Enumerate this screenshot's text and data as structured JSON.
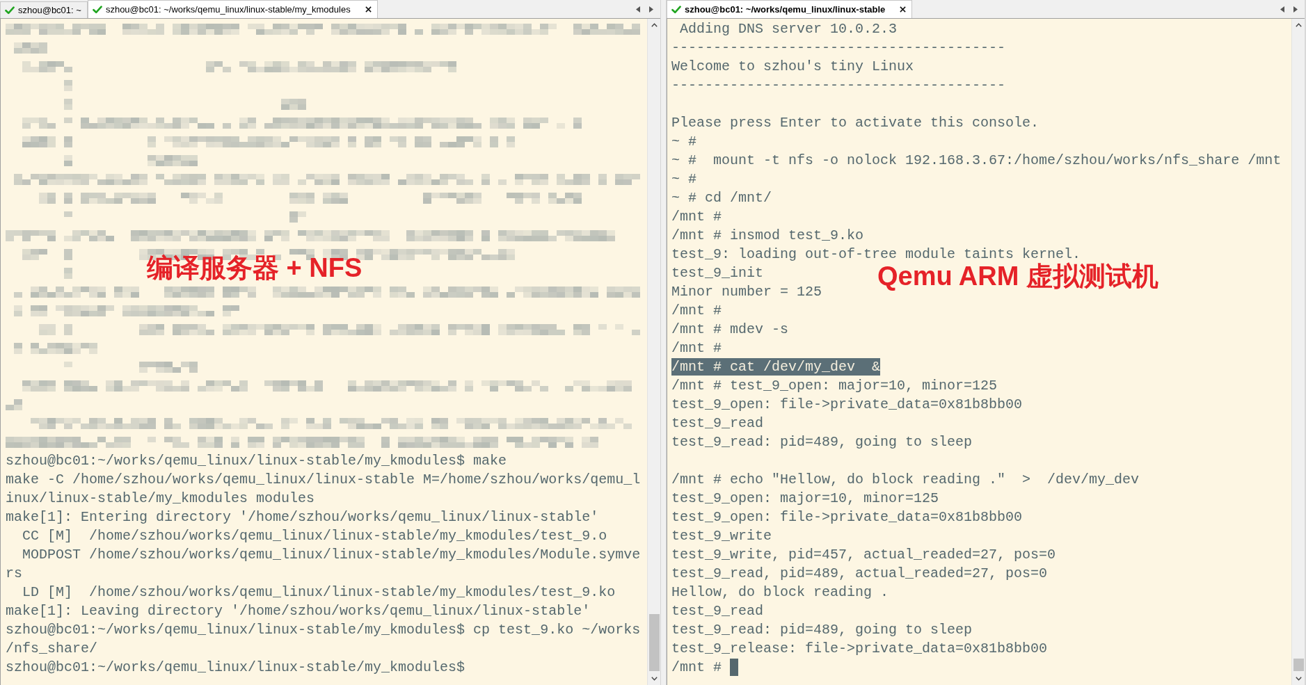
{
  "panes": [
    {
      "focused": false,
      "pixelated": true,
      "tabs": [
        {
          "label": "szhou@bc01: ~",
          "selected": false
        },
        {
          "label": "szhou@bc01: ~/works/qemu_linux/linux-stable/my_kmodules",
          "selected": true
        }
      ],
      "blocks": [
        {
          "lines": [
            {
              "text": "szhou@bc01:~/works/qemu_linux/linux-stable/my_kmodules$ make",
              "selected": false
            },
            {
              "text": "make -C /home/szhou/works/qemu_linux/linux-stable M=/home/szhou/works/qemu_l",
              "selected": false
            },
            {
              "text": "inux/linux-stable/my_kmodules modules",
              "selected": false
            },
            {
              "text": "make[1]: Entering directory '/home/szhou/works/qemu_linux/linux-stable'",
              "selected": false
            },
            {
              "text": "  CC [M]  /home/szhou/works/qemu_linux/linux-stable/my_kmodules/test_9.o",
              "selected": false
            },
            {
              "text": "  MODPOST /home/szhou/works/qemu_linux/linux-stable/my_kmodules/Module.symve",
              "selected": false
            },
            {
              "text": "rs",
              "selected": false
            },
            {
              "text": "  LD [M]  /home/szhou/works/qemu_linux/linux-stable/my_kmodules/test_9.ko",
              "selected": false
            },
            {
              "text": "make[1]: Leaving directory '/home/szhou/works/qemu_linux/linux-stable'",
              "selected": false
            },
            {
              "text": "szhou@bc01:~/works/qemu_linux/linux-stable/my_kmodules$ cp test_9.ko ~/works",
              "selected": false
            },
            {
              "text": "/nfs_share/",
              "selected": false
            },
            {
              "text": "szhou@bc01:~/works/qemu_linux/linux-stable/my_kmodules$",
              "selected": false
            }
          ]
        }
      ],
      "annotation": "编译服务器 + NFS"
    },
    {
      "focused": true,
      "tabs": [
        {
          "label": "szhou@bc01: ~/works/qemu_linux/linux-stable",
          "selected": true
        }
      ],
      "blocks": [
        {
          "lines": [
            {
              "text": " Adding DNS server 10.0.2.3",
              "selected": false
            },
            {
              "text": "----------------------------------------",
              "selected": false
            },
            {
              "text": "Welcome to szhou's tiny Linux",
              "selected": false
            },
            {
              "text": "----------------------------------------",
              "selected": false
            }
          ]
        },
        {
          "lines": [
            {
              "text": "Please press Enter to activate this console.",
              "selected": false
            },
            {
              "text": "~ #",
              "selected": false
            },
            {
              "text": "~ #  mount -t nfs -o nolock 192.168.3.67:/home/szhou/works/nfs_share /mnt",
              "selected": false
            },
            {
              "text": "~ #",
              "selected": false
            },
            {
              "text": "~ # cd /mnt/",
              "selected": false
            },
            {
              "text": "/mnt #",
              "selected": false
            },
            {
              "text": "/mnt # insmod test_9.ko",
              "selected": false
            },
            {
              "text": "test_9: loading out-of-tree module taints kernel.",
              "selected": false
            },
            {
              "text": "test_9_init",
              "selected": false
            },
            {
              "text": "Minor number = 125",
              "selected": false
            },
            {
              "text": "/mnt #",
              "selected": false
            },
            {
              "text": "/mnt # mdev -s",
              "selected": false
            },
            {
              "text": "/mnt #",
              "selected": false
            },
            {
              "text": "/mnt # cat /dev/my_dev  &",
              "selected": true
            },
            {
              "text": "/mnt # test_9_open: major=10, minor=125",
              "selected": false
            },
            {
              "text": "test_9_open: file->private_data=0x81b8bb00",
              "selected": false
            },
            {
              "text": "test_9_read",
              "selected": false
            },
            {
              "text": "test_9_read: pid=489, going to sleep",
              "selected": false
            }
          ]
        },
        {
          "lines": [
            {
              "text": "/mnt # echo \"Hellow, do block reading .\"  >  /dev/my_dev",
              "selected": false
            },
            {
              "text": "test_9_open: major=10, minor=125",
              "selected": false
            },
            {
              "text": "test_9_open: file->private_data=0x81b8bb00",
              "selected": false
            },
            {
              "text": "test_9_write",
              "selected": false
            },
            {
              "text": "test_9_write, pid=457, actual_readed=27, pos=0",
              "selected": false
            },
            {
              "text": "test_9_read, pid=489, actual_readed=27, pos=0",
              "selected": false
            },
            {
              "text": "Hellow, do block reading .",
              "selected": false
            },
            {
              "text": "test_9_read",
              "selected": false
            },
            {
              "text": "test_9_read: pid=489, going to sleep",
              "selected": false
            },
            {
              "text": "test_9_release: file->private_data=0x81b8bb00",
              "selected": false
            }
          ]
        }
      ],
      "prompt": {
        "text": "/mnt #",
        "cursor": true
      },
      "annotation": "Qemu ARM 虚拟测试机"
    }
  ]
}
